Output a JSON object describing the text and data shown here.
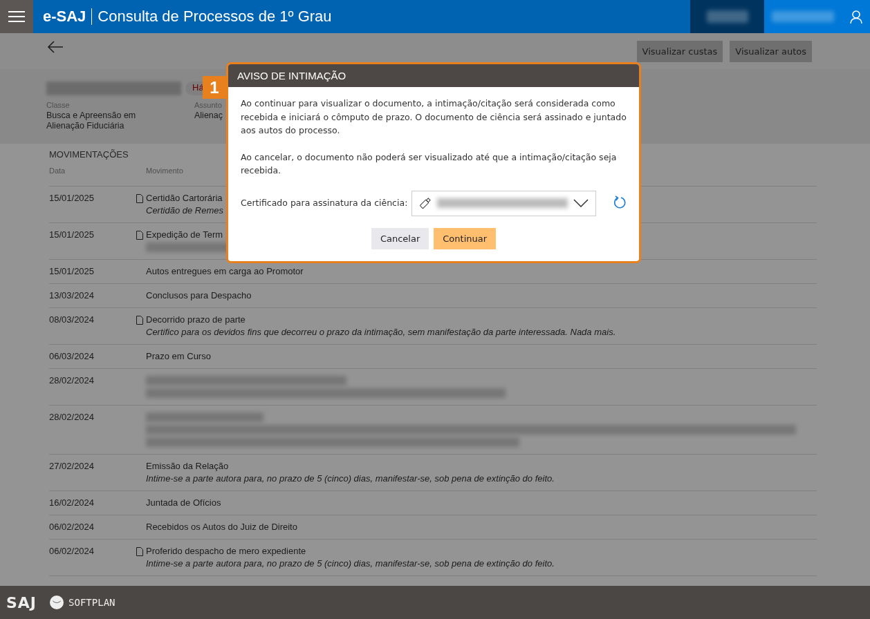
{
  "header": {
    "brand": "e-SAJ",
    "title": "Consulta de Processos de 1º Grau"
  },
  "toolbar": {
    "buttons": [
      "Visualizar custas",
      "Visualizar autos"
    ]
  },
  "process": {
    "badge": "Há",
    "fields": [
      {
        "label": "Classe",
        "value": "Busca e Apreensão em Alienação Fiduciária"
      },
      {
        "label": "Assunto",
        "value": "Alienaç"
      }
    ]
  },
  "movements": {
    "title": "MOVIMENTAÇÕES",
    "columns": [
      "Data",
      "Movimento"
    ],
    "rows": [
      {
        "kind": "text",
        "date": "15/01/2025",
        "document": true,
        "title": "Certidão Cartorária",
        "description": "Certidão de Remes"
      },
      {
        "kind": "text",
        "date": "15/01/2025",
        "document": true,
        "title": "Expedição de Term",
        "description_redacted": true
      },
      {
        "kind": "text",
        "date": "15/01/2025",
        "document": false,
        "title": "Autos entregues em carga ao Promotor"
      },
      {
        "kind": "text",
        "date": "13/03/2024",
        "document": false,
        "title": "Conclusos para Despacho"
      },
      {
        "kind": "text",
        "date": "08/03/2024",
        "document": true,
        "title": "Decorrido prazo de parte",
        "description": "Certifico para os devidos fins que decorreu o prazo da intimação, sem manifestação da parte interessada. Nada mais."
      },
      {
        "kind": "text",
        "date": "06/03/2024",
        "document": false,
        "title": "Prazo em Curso"
      },
      {
        "kind": "redacted",
        "date": "28/02/2024",
        "document": false
      },
      {
        "kind": "redacted_long",
        "date": "28/02/2024",
        "document": false
      },
      {
        "kind": "text",
        "date": "27/02/2024",
        "document": false,
        "title": "Emissão da Relação",
        "description": "Intime-se a parte autora para, no prazo de 5 (cinco) dias, manifestar-se, sob pena de extinção do feito."
      },
      {
        "kind": "text",
        "date": "16/02/2024",
        "document": false,
        "title": "Juntada de Ofícios"
      },
      {
        "kind": "text",
        "date": "06/02/2024",
        "document": false,
        "title": "Recebidos os Autos do Juiz de Direito"
      },
      {
        "kind": "text",
        "date": "06/02/2024",
        "document": true,
        "title": "Proferido despacho de mero expediente",
        "description": "Intime-se a parte autora para, no prazo de 5 (cinco) dias, manifestar-se, sob pena de extinção do feito."
      }
    ]
  },
  "dialog": {
    "step": "1",
    "title": "AVISO DE INTIMAÇÃO",
    "paragraphs": [
      "Ao continuar para visualizar o documento, a intimação/citação será considerada como recebida e iniciará o cômputo de prazo. O documento de ciência será assinado e juntado aos autos do processo.",
      "Ao cancelar, o documento não poderá ser visualizado até que a intimação/citação seja recebida."
    ],
    "certificate_label": "Certificado para assinatura da ciência:",
    "buttons": [
      {
        "kind": "secondary",
        "label": "Cancelar"
      },
      {
        "kind": "primary",
        "label": "Continuar"
      }
    ]
  },
  "footer": {
    "logos": [
      "SAJ",
      "SOFTPLAN"
    ]
  }
}
